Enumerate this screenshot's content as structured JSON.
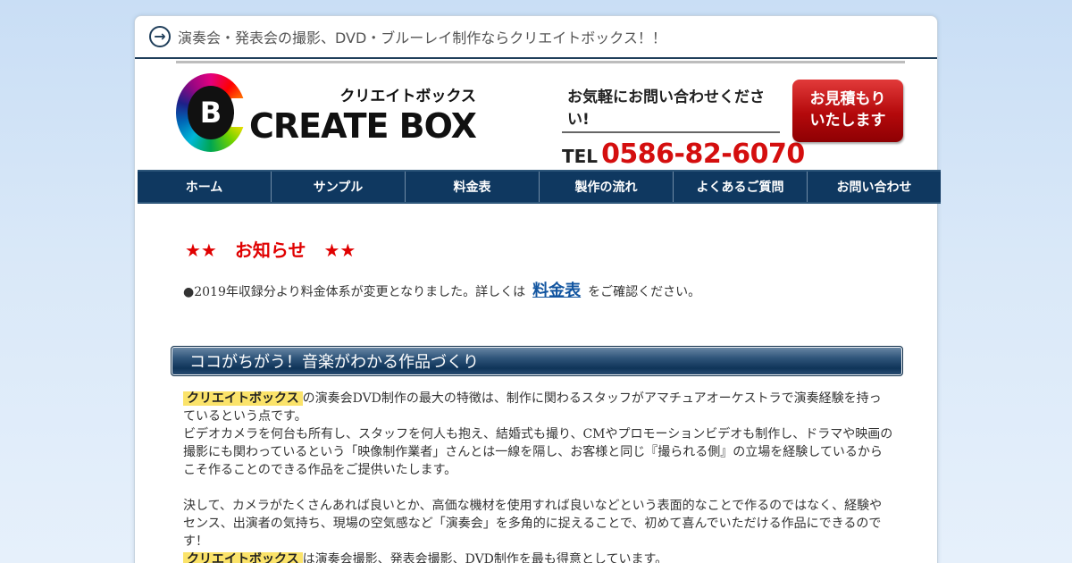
{
  "topbar": {
    "tagline": "演奏会・発表会の撮影、DVD・ブルーレイ制作ならクリエイトボックス！！"
  },
  "header": {
    "logo_letter": "B",
    "logo_kana": "クリエイトボックス",
    "logo_word": "CREATE BOX",
    "contact_message": "お気軽にお問い合わせください!",
    "tel_label": "TEL",
    "tel_number": "0586-82-6070",
    "estimate_line1": "お見積もり",
    "estimate_line2": "いたします"
  },
  "nav": {
    "items": [
      {
        "label": "ホーム"
      },
      {
        "label": "サンプル"
      },
      {
        "label": "料金表"
      },
      {
        "label": "製作の流れ"
      },
      {
        "label": "よくあるご質問"
      },
      {
        "label": "お問い合わせ"
      }
    ]
  },
  "news": {
    "title": "★★　お知らせ　★★",
    "bullet": "●",
    "text_before": "2019年収録分より料金体系が変更となりました。詳しくは",
    "link_label": "料金表",
    "text_after": "をご確認ください。"
  },
  "section": {
    "heading": "ココがちがう！音楽がわかる作品づくり",
    "highlight": "クリエイトボックス",
    "p1_line1": "の演奏会DVD制作の最大の特徴は、制作に関わるスタッフがアマチュアオーケストラで演奏経験を持っ",
    "p1_line2": "ているという点です。",
    "p1_line3": "ビデオカメラを何台も所有し、スタッフを何人も抱え、結婚式も撮り、CMやプロモーションビデオも制作し、ドラマや映画の",
    "p1_line4": "撮影にも関わっているという「映像制作業者」さんとは一線を隔し、お客様と同じ『撮られる側』の立場を経験しているから",
    "p1_line5": "こそ作ることのできる作品をご提供いたします。",
    "p2_line1": "決して、カメラがたくさんあれば良いとか、高価な機材を使用すれば良いなどという表面的なことで作るのではなく、経験や",
    "p2_line2": "センス、出演者の気持ち、現場の空気感など「演奏会」を多角的に捉えることで、初めて喜んでいただける作品にできるので",
    "p2_line3": "す！",
    "p3_text": "は演奏会撮影、発表会撮影、DVD制作を最も得意としています。"
  },
  "colors": {
    "nav_bg": "#0f3860",
    "news_red": "#e00000",
    "tel_red": "#d40e0e",
    "highlight_yellow": "#fbe36a",
    "link_blue": "#1255a0"
  }
}
